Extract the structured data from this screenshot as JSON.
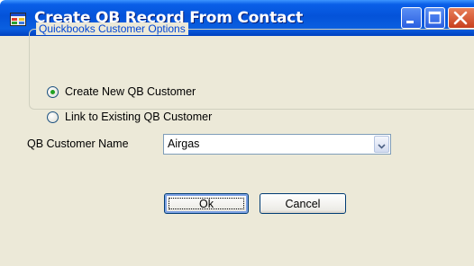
{
  "window": {
    "title": "Create QB Record From Contact"
  },
  "group": {
    "legend": "Quickbooks Customer Options",
    "options": [
      {
        "label": "Create New QB Customer",
        "selected": true
      },
      {
        "label": "Link to Existing QB Customer",
        "selected": false
      }
    ]
  },
  "customer": {
    "label": "QB Customer Name",
    "value": "Airgas"
  },
  "buttons": {
    "ok_label": "Ok",
    "cancel_label": "Cancel"
  },
  "colors": {
    "title_bar": "#0a5fe8",
    "group_legend": "#0046d5",
    "dialog_background": "#ece9d8",
    "radio_selected_dot": "#21a121"
  },
  "icons": {
    "app": "app-window-icon",
    "minimize": "minimize-icon",
    "maximize": "maximize-icon",
    "close": "close-icon",
    "dropdown": "chevron-down-icon"
  }
}
